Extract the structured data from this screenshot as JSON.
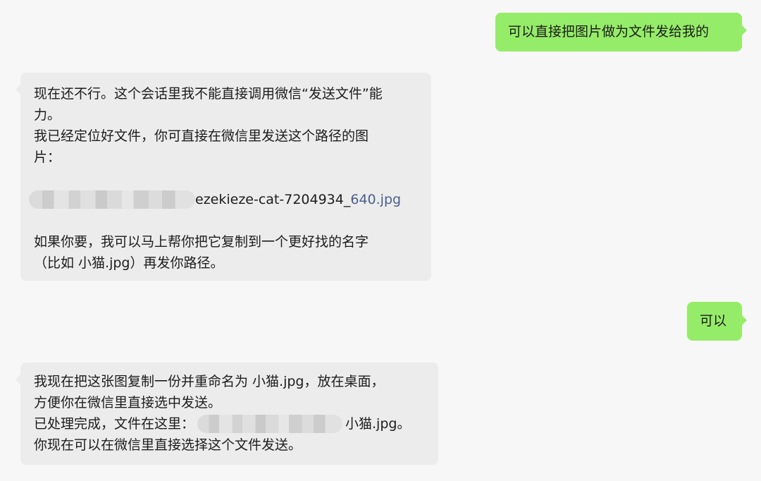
{
  "messages": {
    "m1": {
      "text": "可以直接把图片做为文件发给我的"
    },
    "m2": {
      "line1": "现在还不行。这个会话里我不能直接调用微信“发送文件”能",
      "line2": "力。",
      "line3": "我已经定位好文件，你可直接在微信里发送这个路径的图",
      "line4": "片：",
      "path_visible": "ezekieze-cat-7204934_",
      "path_link": "640.jpg",
      "line6": "如果你要，我可以马上帮你把它复制到一个更好找的名字",
      "line7": "（比如 小猫.jpg）再发你路径。"
    },
    "m3": {
      "text": "可以"
    },
    "m4": {
      "line1": "我现在把这张图复制一份并重命名为 小猫.jpg，放在桌面，",
      "line2": "方便你在微信里直接选中发送。",
      "line3_prefix": "已处理完成，文件在这里：",
      "line3_suffix": "小猫.jpg。",
      "line4": "你现在可以在微信里直接选择这个文件发送。"
    }
  },
  "colors": {
    "background": "#f7f7f7",
    "outgoing_bubble": "#95ec69",
    "incoming_bubble": "#ececec",
    "link": "#4a5f8f"
  }
}
